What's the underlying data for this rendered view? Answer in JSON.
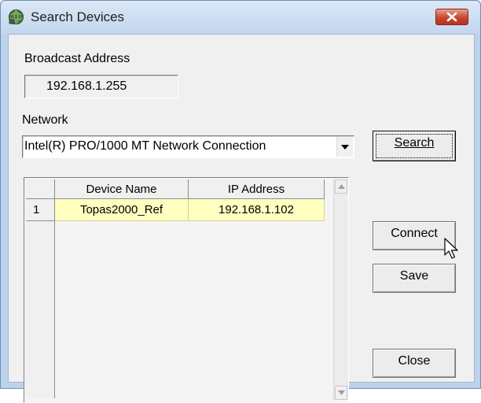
{
  "window": {
    "title": "Search Devices",
    "close_icon": "close-x-icon",
    "app_icon": "globe-network-icon"
  },
  "broadcast": {
    "label": "Broadcast Address",
    "value": "192.168.1.255"
  },
  "network": {
    "label": "Network",
    "selected": "Intel(R) PRO/1000 MT Network Connection"
  },
  "buttons": {
    "search": "Search",
    "connect": "Connect",
    "save": "Save",
    "close": "Close"
  },
  "table": {
    "columns": [
      "Device Name",
      "IP Address"
    ],
    "rows": [
      {
        "index": "1",
        "device_name": "Topas2000_Ref",
        "ip_address": "192.168.1.102"
      }
    ],
    "selected_row_color": "#ffffc0"
  },
  "colors": {
    "titlebar": "#c9dbf0",
    "close_button": "#c8452f",
    "client_bg": "#f0f0f0"
  }
}
